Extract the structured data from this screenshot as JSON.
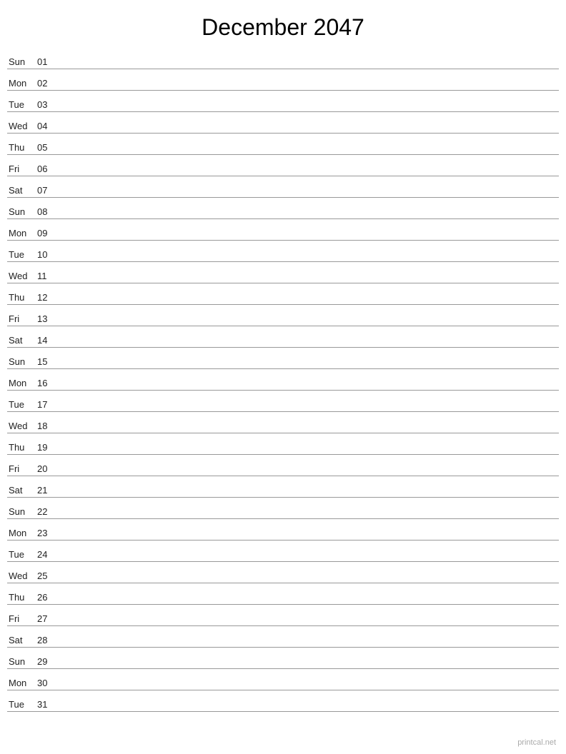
{
  "header": {
    "title": "December 2047"
  },
  "days": [
    {
      "name": "Sun",
      "number": "01"
    },
    {
      "name": "Mon",
      "number": "02"
    },
    {
      "name": "Tue",
      "number": "03"
    },
    {
      "name": "Wed",
      "number": "04"
    },
    {
      "name": "Thu",
      "number": "05"
    },
    {
      "name": "Fri",
      "number": "06"
    },
    {
      "name": "Sat",
      "number": "07"
    },
    {
      "name": "Sun",
      "number": "08"
    },
    {
      "name": "Mon",
      "number": "09"
    },
    {
      "name": "Tue",
      "number": "10"
    },
    {
      "name": "Wed",
      "number": "11"
    },
    {
      "name": "Thu",
      "number": "12"
    },
    {
      "name": "Fri",
      "number": "13"
    },
    {
      "name": "Sat",
      "number": "14"
    },
    {
      "name": "Sun",
      "number": "15"
    },
    {
      "name": "Mon",
      "number": "16"
    },
    {
      "name": "Tue",
      "number": "17"
    },
    {
      "name": "Wed",
      "number": "18"
    },
    {
      "name": "Thu",
      "number": "19"
    },
    {
      "name": "Fri",
      "number": "20"
    },
    {
      "name": "Sat",
      "number": "21"
    },
    {
      "name": "Sun",
      "number": "22"
    },
    {
      "name": "Mon",
      "number": "23"
    },
    {
      "name": "Tue",
      "number": "24"
    },
    {
      "name": "Wed",
      "number": "25"
    },
    {
      "name": "Thu",
      "number": "26"
    },
    {
      "name": "Fri",
      "number": "27"
    },
    {
      "name": "Sat",
      "number": "28"
    },
    {
      "name": "Sun",
      "number": "29"
    },
    {
      "name": "Mon",
      "number": "30"
    },
    {
      "name": "Tue",
      "number": "31"
    }
  ],
  "footer": {
    "text": "printcal.net"
  }
}
